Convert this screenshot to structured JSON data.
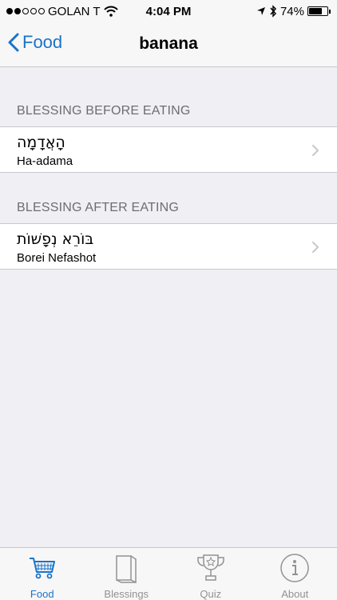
{
  "status_bar": {
    "carrier": "GOLAN T",
    "time": "4:04 PM",
    "battery_percent": "74%",
    "signal_bars_filled": 2,
    "signal_bars_total": 5
  },
  "nav": {
    "back_label": "Food",
    "title": "banana"
  },
  "sections": [
    {
      "header": "BLESSING BEFORE EATING",
      "item": {
        "hebrew": "הָאֲדָמָה",
        "transliteration": "Ha-adama"
      }
    },
    {
      "header": "BLESSING AFTER EATING",
      "item": {
        "hebrew": "בּוֹרֵא נְפָשׁוֹת",
        "transliteration": "Borei Nefashot"
      }
    }
  ],
  "tabs": [
    {
      "label": "Food",
      "icon": "cart-icon",
      "active": true
    },
    {
      "label": "Blessings",
      "icon": "books-icon",
      "active": false
    },
    {
      "label": "Quiz",
      "icon": "trophy-icon",
      "active": false
    },
    {
      "label": "About",
      "icon": "info-icon",
      "active": false
    }
  ],
  "colors": {
    "accent": "#1a73c9",
    "background": "#efeff4",
    "inactive_tab": "#929292"
  }
}
